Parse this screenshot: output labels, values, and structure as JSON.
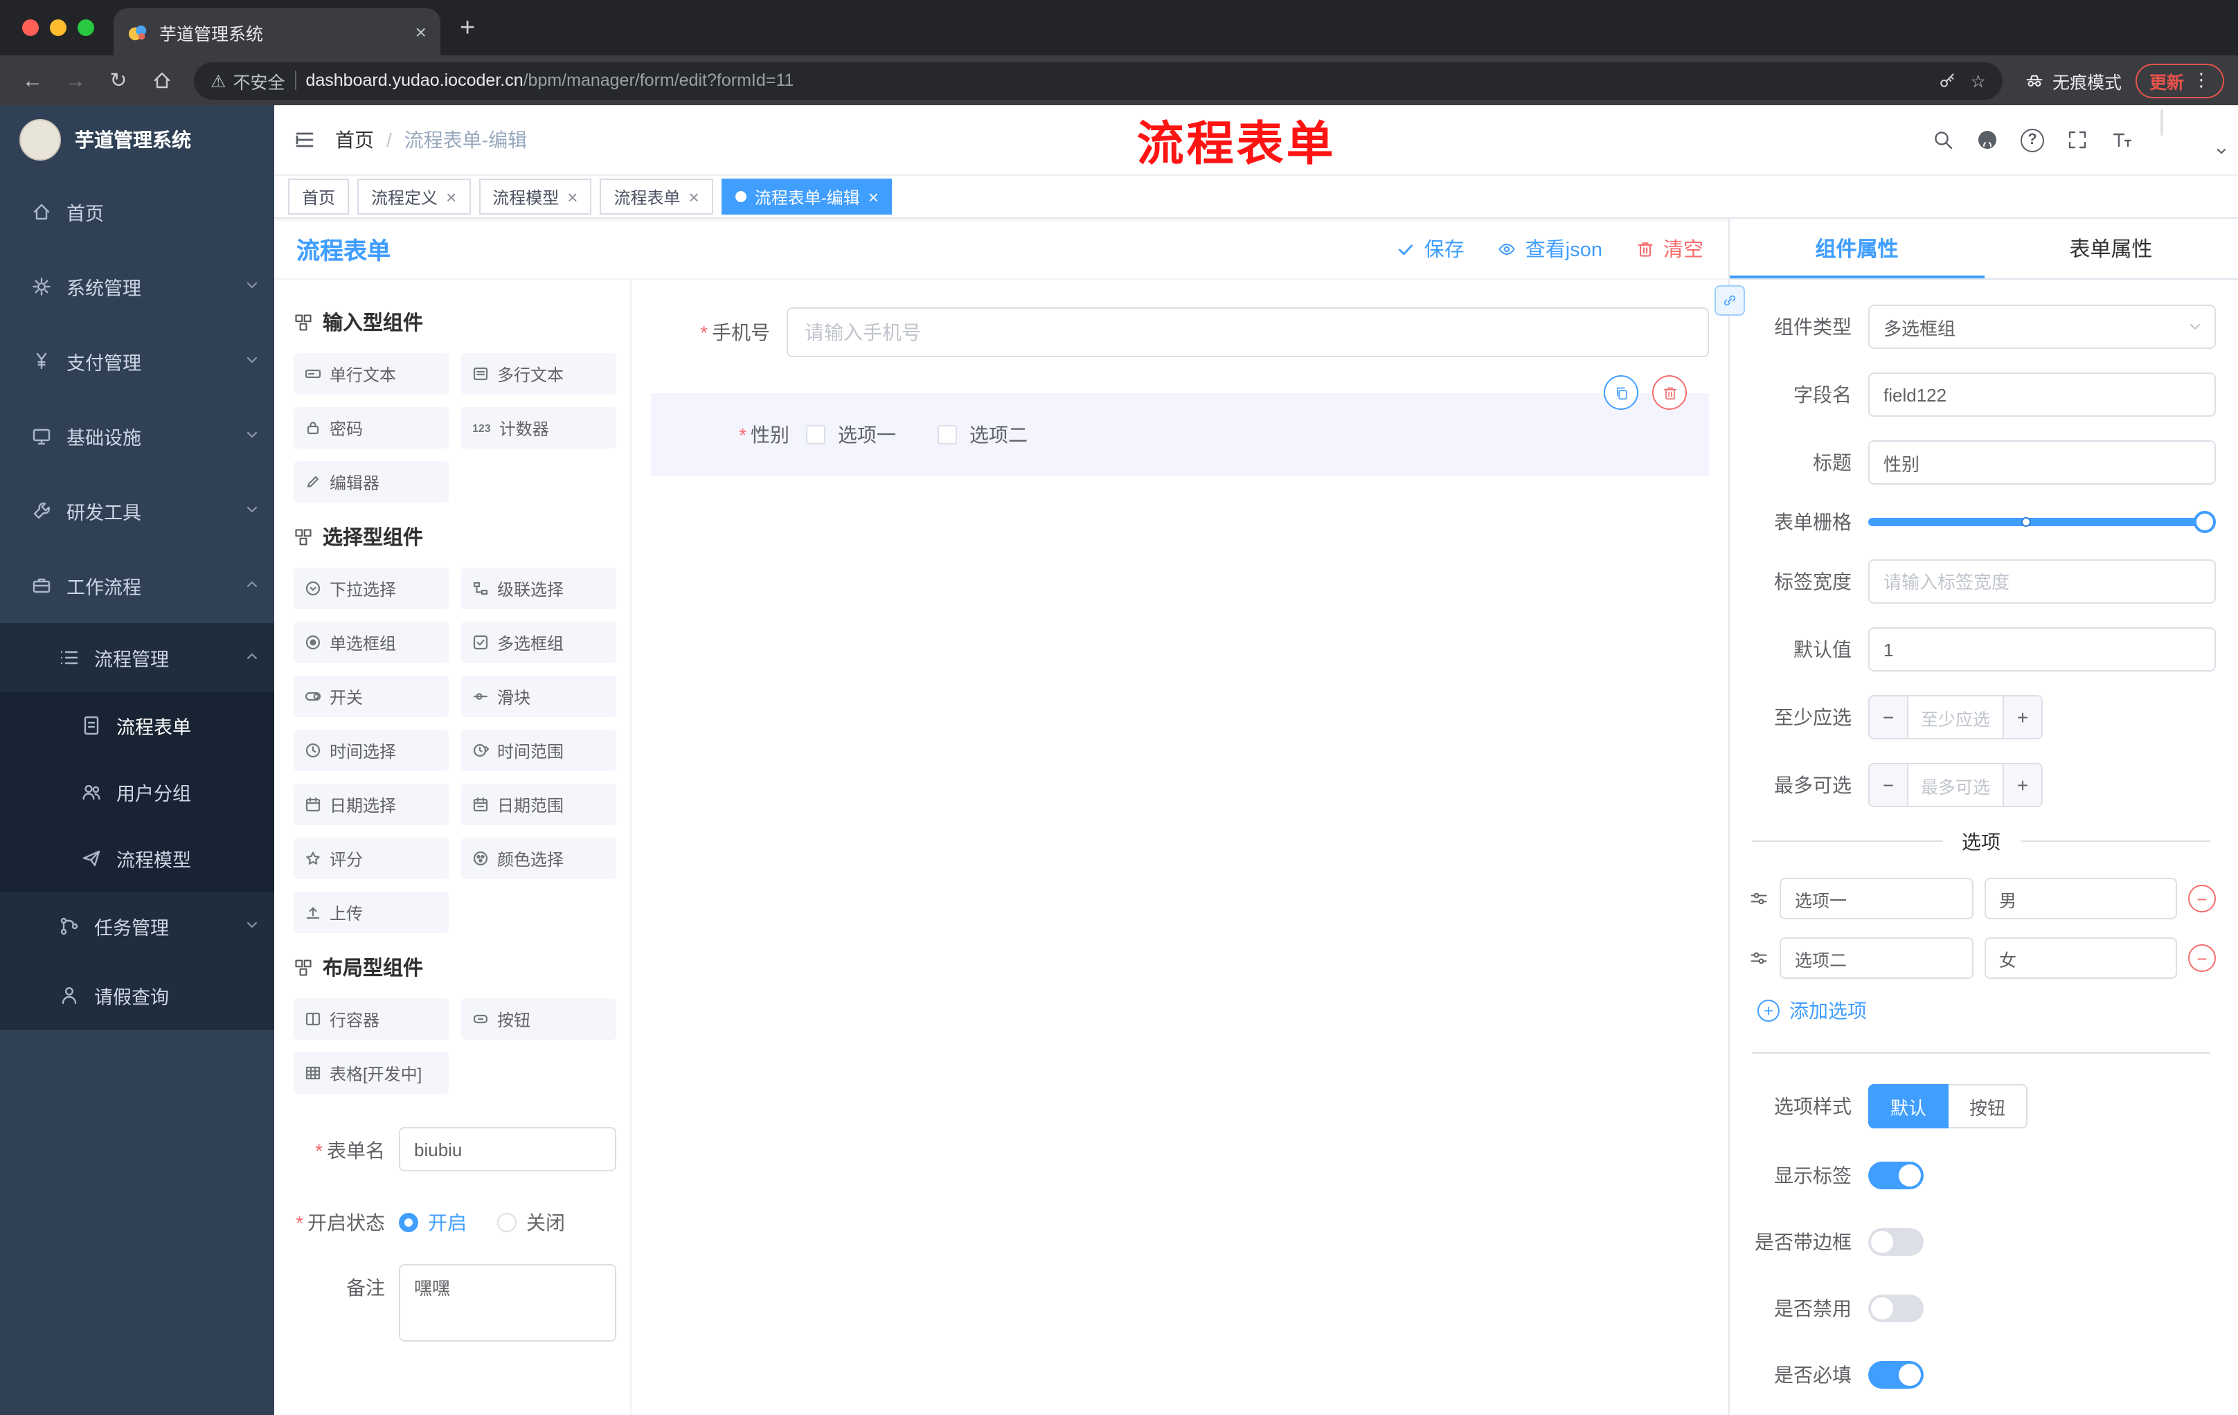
{
  "colors": {
    "primary": "#409EFF",
    "danger": "#F56C6C",
    "sidebar_bg": "#304156",
    "sidebar_sub_bg": "#1F2D3D",
    "tag_active_bg": "#409EFF",
    "annotation_red": "#FF1414"
  },
  "icons": {
    "back": "←",
    "forward": "→",
    "reload": "↻",
    "warning": "⚠",
    "star": "☆",
    "more": "⋮",
    "close": "×",
    "new_tab": "+",
    "question": "?",
    "minus": "−",
    "plus": "+",
    "counter_digits": "123"
  },
  "browser": {
    "tab_title": "芋道管理系统",
    "security_label": "不安全",
    "url_domain": "dashboard.yudao.iocoder.cn",
    "url_path": "/bpm/manager/form/edit?formId=11",
    "incognito_label": "无痕模式",
    "update_label": "更新"
  },
  "sidebar": {
    "app_title": "芋道管理系统",
    "home": "首页",
    "system": "系统管理",
    "payment": "支付管理",
    "infra": "基础设施",
    "devtools": "研发工具",
    "workflow": "工作流程",
    "process_mgmt": "流程管理",
    "process_form": "流程表单",
    "user_group": "用户分组",
    "process_model": "流程模型",
    "task_mgmt": "任务管理",
    "leave_query": "请假查询"
  },
  "header": {
    "breadcrumb_home": "首页",
    "breadcrumb_sep": "/",
    "breadcrumb_current": "流程表单-编辑",
    "overlay_title": "流程表单"
  },
  "tags": {
    "t0": "首页",
    "t1": "流程定义",
    "t2": "流程模型",
    "t3": "流程表单",
    "t4": "流程表单-编辑"
  },
  "designer": {
    "title": "流程表单",
    "save": "保存",
    "view_json": "查看json",
    "clear": "清空",
    "input_section": "输入型组件",
    "select_section": "选择型组件",
    "layout_section": "布局型组件",
    "c_single_text": "单行文本",
    "c_multi_text": "多行文本",
    "c_password": "密码",
    "c_counter": "计数器",
    "c_editor": "编辑器",
    "c_select": "下拉选择",
    "c_cascader": "级联选择",
    "c_radio": "单选框组",
    "c_checkbox": "多选框组",
    "c_switch": "开关",
    "c_slider": "滑块",
    "c_time": "时间选择",
    "c_time_range": "时间范围",
    "c_date": "日期选择",
    "c_date_range": "日期范围",
    "c_rate": "评分",
    "c_color": "颜色选择",
    "c_upload": "上传",
    "c_row": "行容器",
    "c_button": "按钮",
    "c_table": "表格[开发中]",
    "form_name_label": "表单名",
    "form_name_value": "biubiu",
    "status_label": "开启状态",
    "status_on": "开启",
    "status_off": "关闭",
    "remark_label": "备注",
    "remark_value": "嘿嘿"
  },
  "canvas": {
    "phone_label": "手机号",
    "phone_placeholder": "请输入手机号",
    "gender_label": "性别",
    "opt1": "选项一",
    "opt2": "选项二"
  },
  "props": {
    "tab_component": "组件属性",
    "tab_form": "表单属性",
    "type_label": "组件类型",
    "type_value": "多选框组",
    "field_label": "字段名",
    "field_value": "field122",
    "title_label": "标题",
    "title_value": "性别",
    "grid_label": "表单栅格",
    "width_label": "标签宽度",
    "width_placeholder": "请输入标签宽度",
    "default_label": "默认值",
    "default_value": "1",
    "min_label": "至少应选",
    "min_placeholder": "至少应选",
    "max_label": "最多可选",
    "max_placeholder": "最多可选",
    "options_title": "选项",
    "opt1_label": "选项一",
    "opt1_value": "男",
    "opt2_label": "选项二",
    "opt2_value": "女",
    "add_option": "添加选项",
    "style_label": "选项样式",
    "style_default": "默认",
    "style_button": "按钮",
    "show_label": "显示标签",
    "border_label": "是否带边框",
    "disabled_label": "是否禁用",
    "required_label": "是否必填"
  }
}
